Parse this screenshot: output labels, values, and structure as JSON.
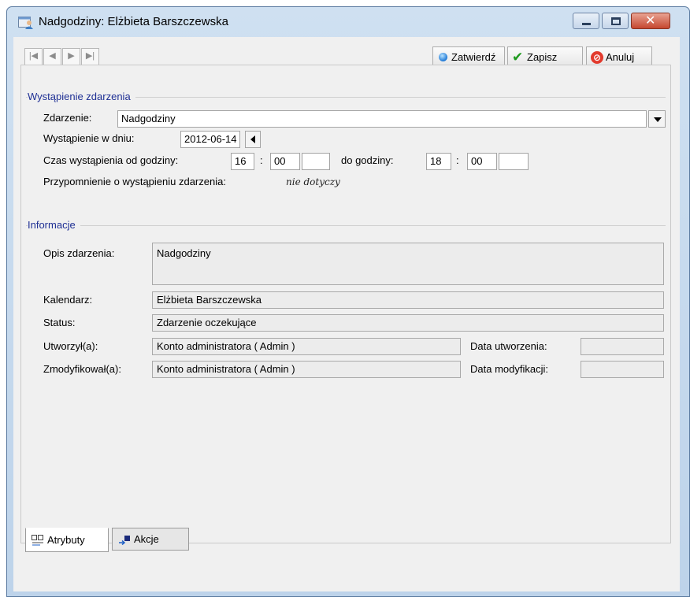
{
  "window": {
    "title": "Nadgodziny: Elżbieta Barszczewska",
    "controls": {
      "minimize": "minimize-icon",
      "maximize": "maximize-icon",
      "close": "close-icon"
    }
  },
  "toolbar": {
    "nav_icons": [
      "first-record-icon",
      "previous-record-icon",
      "next-record-icon",
      "last-record-icon"
    ],
    "confirm_label": "Zatwierdź",
    "save_label": "Zapisz",
    "cancel_label": "Anuluj"
  },
  "event": {
    "group_title": "Wystąpienie zdarzenia",
    "type_label": "Zdarzenie:",
    "type_value": "Nadgodziny",
    "date_label": "Wystąpienie w dniu:",
    "date_value": "2012-06-14",
    "time_from_label": "Czas wystąpienia od godziny:",
    "from_hour": "16",
    "from_minute": "00",
    "from_extra": "",
    "time_separator": ":",
    "time_to_label": "do godziny:",
    "to_hour": "18",
    "to_minute": "00",
    "to_extra": "",
    "reminder_label": "Przypomnienie o wystąpieniu zdarzenia:",
    "reminder_value": "nie dotyczy"
  },
  "info": {
    "group_title": "Informacje",
    "description_label": "Opis zdarzenia:",
    "description_value": "Nadgodziny",
    "calendar_label": "Kalendarz:",
    "calendar_value": "Elżbieta Barszczewska",
    "status_label": "Status:",
    "status_value": "Zdarzenie oczekujące",
    "created_by_label": "Utworzył(a):",
    "created_by_value": "Konto administratora ( Admin )",
    "created_date_label": "Data utworzenia:",
    "created_date_value": "",
    "modified_by_label": "Zmodyfikował(a):",
    "modified_by_value": "Konto administratora ( Admin )",
    "modified_date_label": "Data modyfikacji:",
    "modified_date_value": ""
  },
  "tabs": [
    {
      "label": "Atrybuty",
      "icon": "attributes-icon",
      "active": true
    },
    {
      "label": "Akcje",
      "icon": "actions-icon",
      "active": false
    }
  ]
}
